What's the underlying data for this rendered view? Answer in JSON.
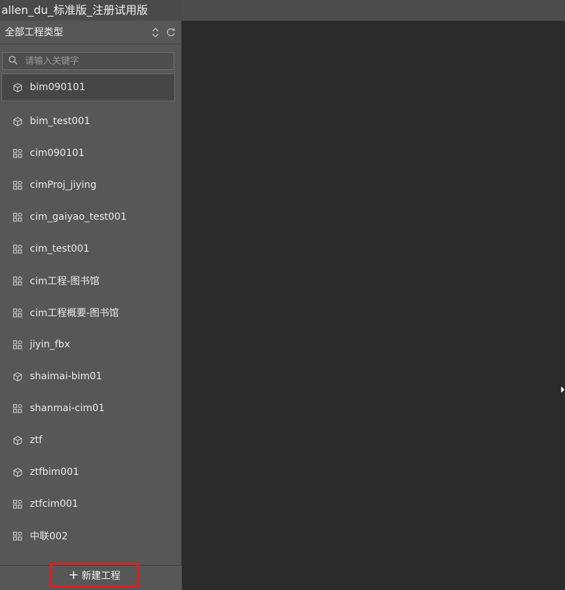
{
  "window": {
    "title": "allen_du_标准版_注册试用版"
  },
  "header": {
    "filter_label": "全部工程类型",
    "sort_icon": "sort-updown-icon",
    "refresh_icon": "refresh-icon"
  },
  "search": {
    "placeholder": "请输入关键字",
    "value": ""
  },
  "projects": [
    {
      "name": "bim090101",
      "type": "bim",
      "icon": "cube-icon",
      "selected": true
    },
    {
      "name": "bim_test001",
      "type": "bim",
      "icon": "cube-icon"
    },
    {
      "name": "cim090101",
      "type": "cim",
      "icon": "grid-icon"
    },
    {
      "name": "cimProj_jiying",
      "type": "cim",
      "icon": "grid-icon"
    },
    {
      "name": "cim_gaiyao_test001",
      "type": "cim",
      "icon": "grid-icon"
    },
    {
      "name": "cim_test001",
      "type": "cim",
      "icon": "grid-icon"
    },
    {
      "name": "cim工程-图书馆",
      "type": "cim",
      "icon": "grid-icon"
    },
    {
      "name": "cim工程概要-图书馆",
      "type": "cim",
      "icon": "grid-icon"
    },
    {
      "name": "jiyin_fbx",
      "type": "cim",
      "icon": "grid-icon"
    },
    {
      "name": "shaimai-bim01",
      "type": "bim",
      "icon": "cube-icon"
    },
    {
      "name": "shanmai-cim01",
      "type": "cim",
      "icon": "grid-icon"
    },
    {
      "name": "ztf",
      "type": "bim",
      "icon": "cube-icon"
    },
    {
      "name": "ztfbim001",
      "type": "bim",
      "icon": "cube-icon"
    },
    {
      "name": "ztfcim001",
      "type": "cim",
      "icon": "grid-icon"
    },
    {
      "name": "中联002",
      "type": "cim",
      "icon": "grid-icon"
    }
  ],
  "footer": {
    "new_project_label": "新建工程",
    "plus_icon": "plus-icon"
  },
  "colors": {
    "sidebar_bg": "#575757",
    "main_bg": "#2b2b2b",
    "highlight_border": "#e21d1d"
  }
}
